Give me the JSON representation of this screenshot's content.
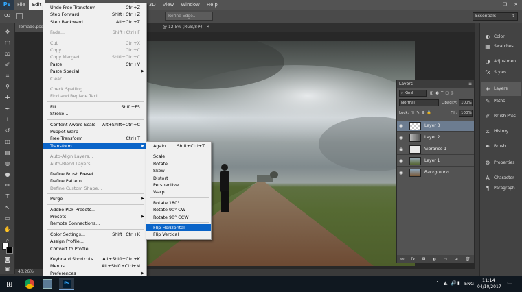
{
  "app": {
    "logo": "Ps"
  },
  "menubar": {
    "items": [
      "File",
      "Edit",
      "Image",
      "Layer",
      "Type",
      "Select",
      "Filter",
      "3D",
      "View",
      "Window",
      "Help"
    ],
    "active_index": 1
  },
  "options_bar": {
    "refine_edge": "Refine Edge...",
    "workspace": "Essentials"
  },
  "document_tabs": [
    "Tornado.psd",
    "@ 12.5% (RGB/8#)"
  ],
  "status": {
    "zoom": "40.26%"
  },
  "edit_menu": [
    {
      "label": "Undo Free Transform",
      "shortcut": "Ctrl+Z"
    },
    {
      "label": "Step Forward",
      "shortcut": "Shift+Ctrl+Z"
    },
    {
      "label": "Step Backward",
      "shortcut": "Alt+Ctrl+Z"
    },
    {
      "label": "Fade...",
      "shortcut": "Shift+Ctrl+F",
      "disabled": true
    },
    {
      "label": "Cut",
      "shortcut": "Ctrl+X",
      "disabled": true
    },
    {
      "label": "Copy",
      "shortcut": "Ctrl+C",
      "disabled": true
    },
    {
      "label": "Copy Merged",
      "shortcut": "Shift+Ctrl+C",
      "disabled": true
    },
    {
      "label": "Paste",
      "shortcut": "Ctrl+V"
    },
    {
      "label": "Paste Special",
      "shortcut": "",
      "submenu": true
    },
    {
      "label": "Clear",
      "shortcut": "",
      "disabled": true
    },
    {
      "label": "Check Spelling...",
      "shortcut": "",
      "disabled": true
    },
    {
      "label": "Find and Replace Text...",
      "shortcut": "",
      "disabled": true
    },
    {
      "label": "Fill...",
      "shortcut": "Shift+F5"
    },
    {
      "label": "Stroke...",
      "shortcut": ""
    },
    {
      "label": "Content-Aware Scale",
      "shortcut": "Alt+Shift+Ctrl+C"
    },
    {
      "label": "Puppet Warp",
      "shortcut": ""
    },
    {
      "label": "Free Transform",
      "shortcut": "Ctrl+T"
    },
    {
      "label": "Transform",
      "shortcut": "",
      "submenu": true,
      "highlighted": true
    },
    {
      "label": "Auto-Align Layers...",
      "shortcut": "",
      "disabled": true
    },
    {
      "label": "Auto-Blend Layers...",
      "shortcut": "",
      "disabled": true
    },
    {
      "label": "Define Brush Preset...",
      "shortcut": ""
    },
    {
      "label": "Define Pattern...",
      "shortcut": ""
    },
    {
      "label": "Define Custom Shape...",
      "shortcut": "",
      "disabled": true
    },
    {
      "label": "Purge",
      "shortcut": "",
      "submenu": true
    },
    {
      "label": "Adobe PDF Presets...",
      "shortcut": ""
    },
    {
      "label": "Presets",
      "shortcut": "",
      "submenu": true
    },
    {
      "label": "Remote Connections...",
      "shortcut": ""
    },
    {
      "label": "Color Settings...",
      "shortcut": "Shift+Ctrl+K"
    },
    {
      "label": "Assign Profile...",
      "shortcut": ""
    },
    {
      "label": "Convert to Profile...",
      "shortcut": ""
    },
    {
      "label": "Keyboard Shortcuts...",
      "shortcut": "Alt+Shift+Ctrl+K"
    },
    {
      "label": "Menus...",
      "shortcut": "Alt+Shift+Ctrl+M"
    },
    {
      "label": "Preferences",
      "shortcut": "",
      "submenu": true
    }
  ],
  "transform_menu": [
    {
      "label": "Again",
      "shortcut": "Shift+Ctrl+T"
    },
    {
      "label": "Scale",
      "shortcut": ""
    },
    {
      "label": "Rotate",
      "shortcut": ""
    },
    {
      "label": "Skew",
      "shortcut": ""
    },
    {
      "label": "Distort",
      "shortcut": ""
    },
    {
      "label": "Perspective",
      "shortcut": ""
    },
    {
      "label": "Warp",
      "shortcut": ""
    },
    {
      "label": "Rotate 180°",
      "shortcut": ""
    },
    {
      "label": "Rotate 90° CW",
      "shortcut": ""
    },
    {
      "label": "Rotate 90° CCW",
      "shortcut": ""
    },
    {
      "label": "Flip Horizontal",
      "shortcut": "",
      "highlighted": true
    },
    {
      "label": "Flip Vertical",
      "shortcut": ""
    }
  ],
  "dock": [
    {
      "label": "Color",
      "icon": "color-wheel-icon",
      "glyph": "◐"
    },
    {
      "label": "Swatches",
      "icon": "swatches-icon",
      "glyph": "▦"
    },
    {
      "label": "Adjustmen...",
      "icon": "adjustments-icon",
      "glyph": "◑"
    },
    {
      "label": "Styles",
      "icon": "styles-icon",
      "glyph": "fx"
    },
    {
      "label": "Layers",
      "icon": "layers-icon",
      "glyph": "◈"
    },
    {
      "label": "Paths",
      "icon": "paths-icon",
      "glyph": "✎"
    },
    {
      "label": "Brush Pres...",
      "icon": "brush-presets-icon",
      "glyph": "✐"
    },
    {
      "label": "History",
      "icon": "history-icon",
      "glyph": "⧖"
    },
    {
      "label": "Brush",
      "icon": "brush-icon",
      "glyph": "✒"
    },
    {
      "label": "Properties",
      "icon": "properties-icon",
      "glyph": "⚙"
    },
    {
      "label": "Character",
      "icon": "character-icon",
      "glyph": "A"
    },
    {
      "label": "Paragraph",
      "icon": "paragraph-icon",
      "glyph": "¶"
    }
  ],
  "layers_panel": {
    "title": "Layers",
    "kind": "Kind",
    "blend_mode": "Normal",
    "opacity_label": "Opacity:",
    "opacity": "100%",
    "lock_label": "Lock:",
    "fill_label": "Fill:",
    "fill": "100%",
    "layers": [
      {
        "name": "Layer 3",
        "selected": true
      },
      {
        "name": "Layer 2",
        "selected": false
      },
      {
        "name": "Vibrance 1",
        "selected": false
      },
      {
        "name": "Layer 1",
        "selected": false
      },
      {
        "name": "Background",
        "selected": false
      }
    ]
  },
  "tray": {
    "language": "ENG",
    "time": "11:14",
    "date": "04/10/2017"
  }
}
